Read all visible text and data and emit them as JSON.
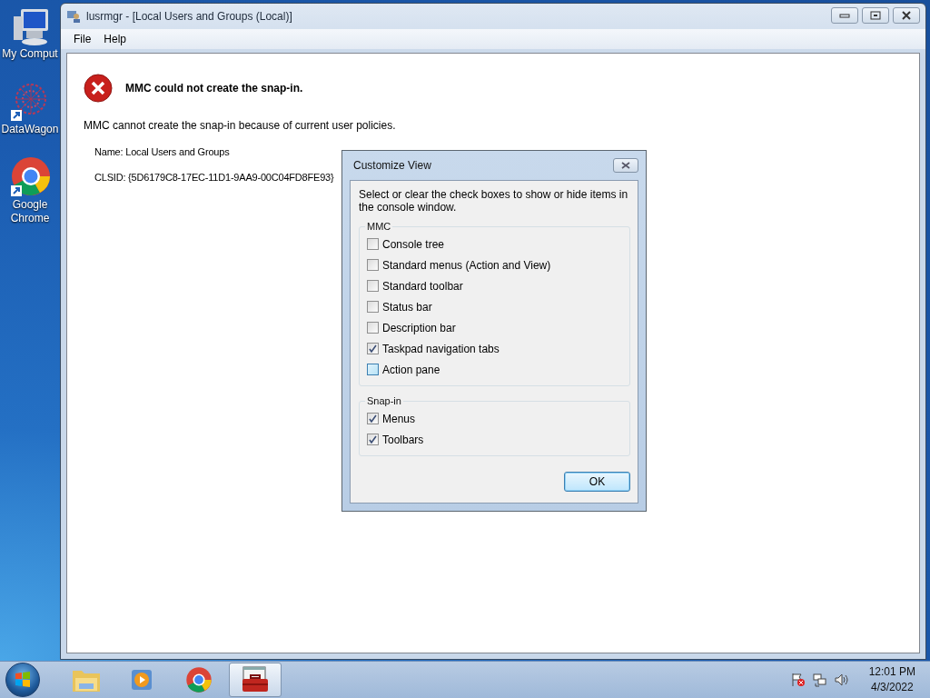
{
  "desktop_icons": [
    {
      "kind": "computer",
      "label": "My Comput"
    },
    {
      "kind": "network",
      "label": "DataWagon"
    },
    {
      "kind": "chrome",
      "label": "Google Chrome"
    }
  ],
  "window": {
    "title": "lusrmgr - [Local Users and Groups (Local)]",
    "menu": [
      "File",
      "Help"
    ]
  },
  "error": {
    "heading": "MMC could not create the snap-in.",
    "message": "MMC cannot create the snap-in because of current user policies.",
    "details": [
      "Name: Local Users and Groups",
      "CLSID: {5D6179C8-17EC-11D1-9AA9-00C04FD8FE93}"
    ]
  },
  "dialog": {
    "title": "Customize View",
    "instructions": "Select or clear the check boxes to show or hide items in the console window.",
    "groups": [
      {
        "label": "MMC",
        "options": [
          {
            "label": "Console tree",
            "checked": false,
            "hovered": false
          },
          {
            "label": "Standard menus (Action and View)",
            "checked": false,
            "hovered": false
          },
          {
            "label": "Standard toolbar",
            "checked": false,
            "hovered": false
          },
          {
            "label": "Status bar",
            "checked": false,
            "hovered": false
          },
          {
            "label": "Description bar",
            "checked": false,
            "hovered": false
          },
          {
            "label": "Taskpad navigation tabs",
            "checked": true,
            "hovered": false
          },
          {
            "label": "Action pane",
            "checked": false,
            "hovered": true
          }
        ]
      },
      {
        "label": "Snap-in",
        "options": [
          {
            "label": "Menus",
            "checked": true,
            "hovered": false
          },
          {
            "label": "Toolbars",
            "checked": true,
            "hovered": false
          }
        ]
      }
    ],
    "ok_button": "OK"
  },
  "taskbar": {
    "apps": [
      {
        "kind": "explorer",
        "selected": false
      },
      {
        "kind": "media",
        "selected": false
      },
      {
        "kind": "chrome",
        "selected": false
      },
      {
        "kind": "toolbox",
        "selected": true
      }
    ],
    "clock": {
      "time": "12:01 PM",
      "date": "4/3/2022"
    }
  }
}
